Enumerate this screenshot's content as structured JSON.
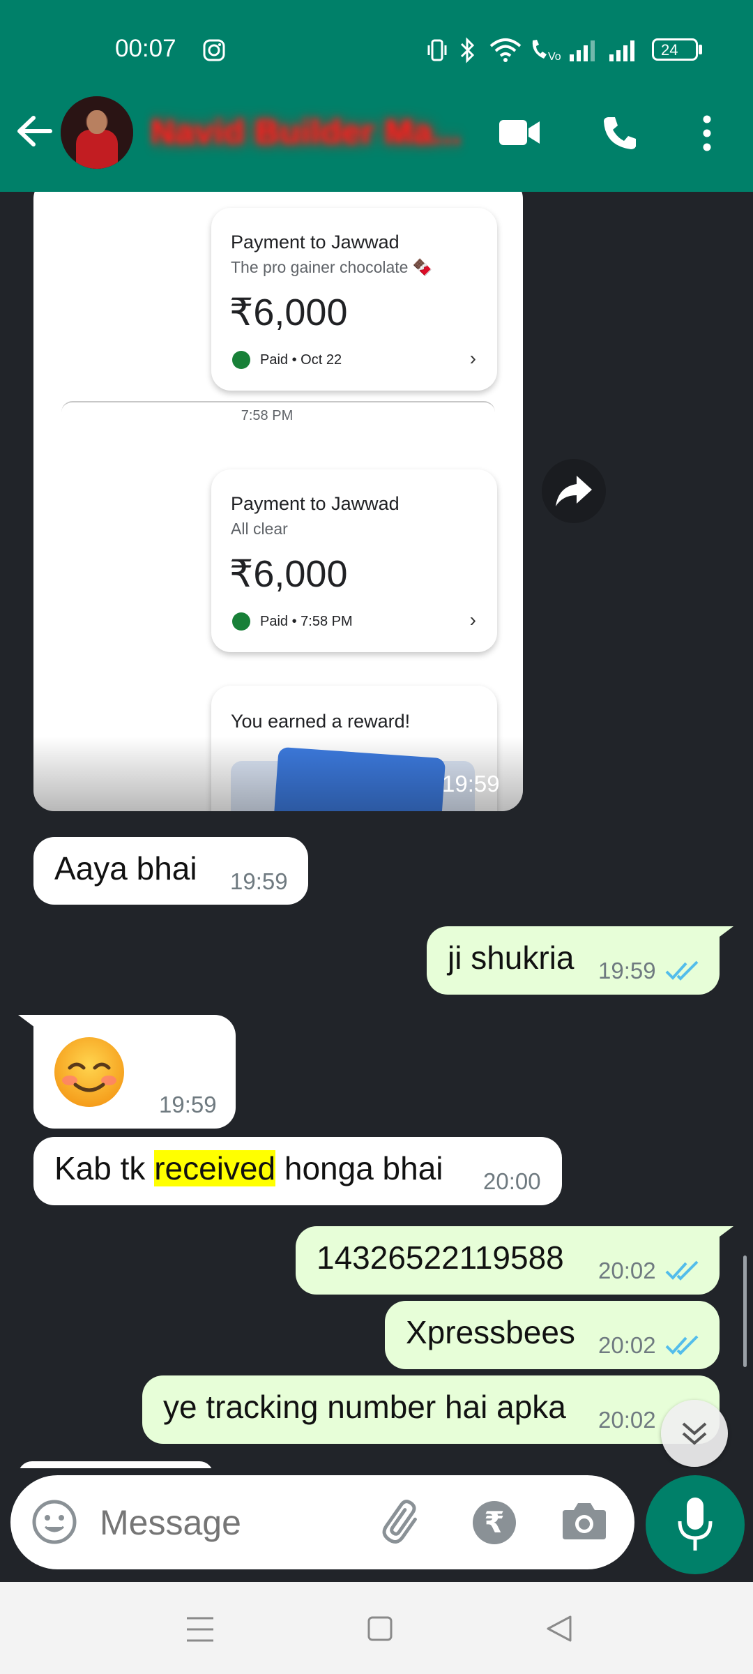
{
  "status_bar": {
    "time": "00:07",
    "battery": "24"
  },
  "header": {
    "contact_name": "Navid Builder Ma..."
  },
  "image_message": {
    "card1": {
      "title": "Payment to Jawwad",
      "note": "The pro gainer chocolate 🍫",
      "amount": "₹6,000",
      "status": "Paid • Oct 22"
    },
    "divider_time": "7:58 PM",
    "card2": {
      "title": "Payment to Jawwad",
      "note": "All clear",
      "amount": "₹6,000",
      "status": "Paid • 7:58 PM"
    },
    "card3": {
      "title": "You earned a reward!"
    },
    "time": "19:59"
  },
  "messages": [
    {
      "dir": "in",
      "text": "Aaya bhai",
      "time": "19:59"
    },
    {
      "dir": "out",
      "text": "ji shukria",
      "time": "19:59"
    },
    {
      "dir": "in",
      "text": "☺️",
      "time": "19:59"
    },
    {
      "dir": "in",
      "text_before": "Kab tk ",
      "highlight": "received",
      "text_after": " honga bhai",
      "time": "20:00"
    },
    {
      "dir": "out",
      "text": "14326522119588",
      "time": "20:02"
    },
    {
      "dir": "out",
      "text": "Xpressbees",
      "time": "20:02"
    },
    {
      "dir": "out",
      "text": "ye tracking number hai apka",
      "time": "20:02"
    }
  ],
  "composer": {
    "placeholder": "Message"
  },
  "colors": {
    "header": "#008069",
    "chat_bg": "#212429",
    "outgoing": "#e7fed8",
    "incoming": "#ffffff",
    "tick_read": "#53bdeb",
    "highlight": "#ffff00"
  }
}
